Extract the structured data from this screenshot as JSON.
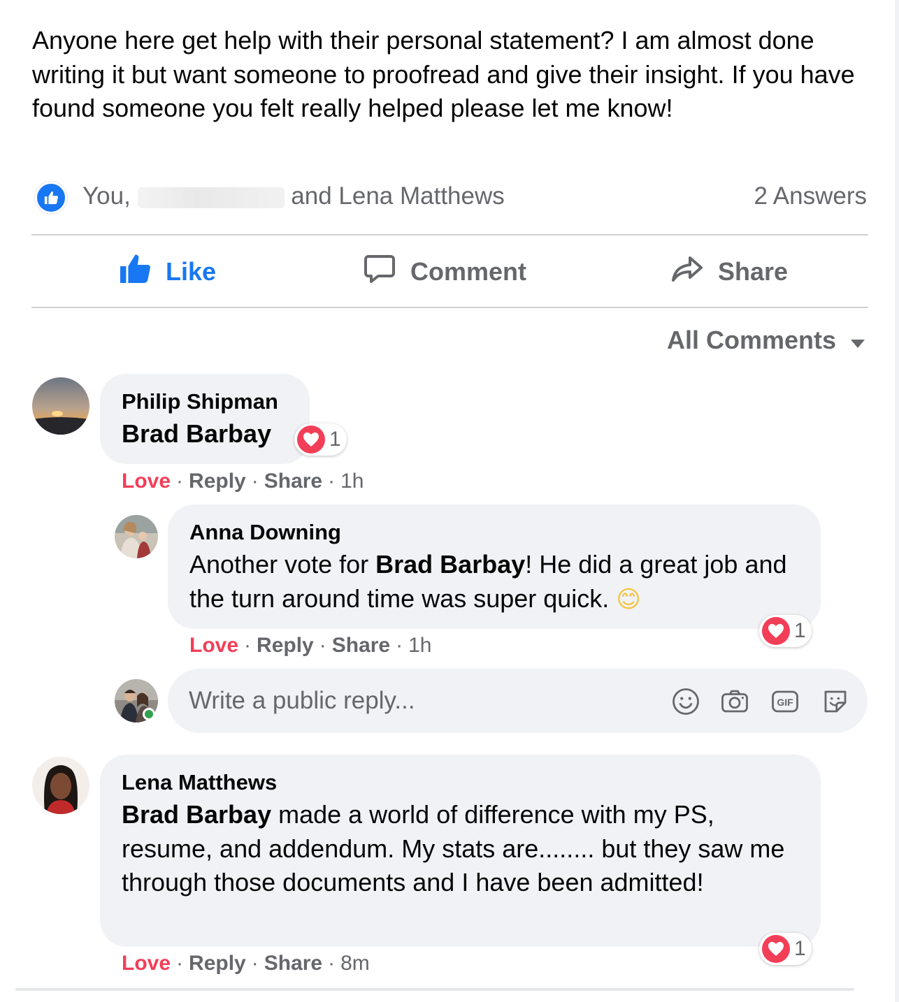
{
  "post": {
    "text": "Anyone here get help with their personal statement? I am almost done writing it but want someone to proofread and give their insight. If you have found someone you felt really helped please let me know!",
    "reactors_prefix": "You,",
    "reactors_suffix": "and Lena Matthews",
    "answers": "2 Answers"
  },
  "actions": {
    "like": "Like",
    "comment": "Comment",
    "share": "Share"
  },
  "sort_label": "All Comments",
  "comments": [
    {
      "author": "Philip Shipman",
      "mention": "Brad Barbay",
      "reaction_count": "1",
      "love": "Love",
      "reply": "Reply",
      "share": "Share",
      "time": "1h"
    },
    {
      "author": "Anna Downing",
      "text_before": "Another vote for ",
      "mention": "Brad Barbay",
      "text_after": "! He did a great job and the turn around time was super quick.",
      "emoji": "😊",
      "reaction_count": "1",
      "love": "Love",
      "reply": "Reply",
      "share": "Share",
      "time": "1h"
    },
    {
      "author": "Lena Matthews",
      "mention": "Brad Barbay",
      "text_after": " made a world of difference with my PS, resume, and addendum. My stats are........ but they saw me through those documents and I have been admitted!",
      "reaction_count": "1",
      "love": "Love",
      "reply": "Reply",
      "share": "Share",
      "time": "8m"
    }
  ],
  "reply_box": {
    "placeholder": "Write a public reply..."
  },
  "colors": {
    "accent": "#1877f2",
    "love": "#f33e58",
    "muted": "#65676b",
    "bubble": "#f0f2f5",
    "online": "#31a24c"
  },
  "icons": [
    "like-icon",
    "thumbs-up-icon",
    "comment-icon",
    "share-icon",
    "caret-down-icon",
    "heart-icon",
    "emoji-icon",
    "camera-icon",
    "gif-icon",
    "sticker-icon"
  ]
}
